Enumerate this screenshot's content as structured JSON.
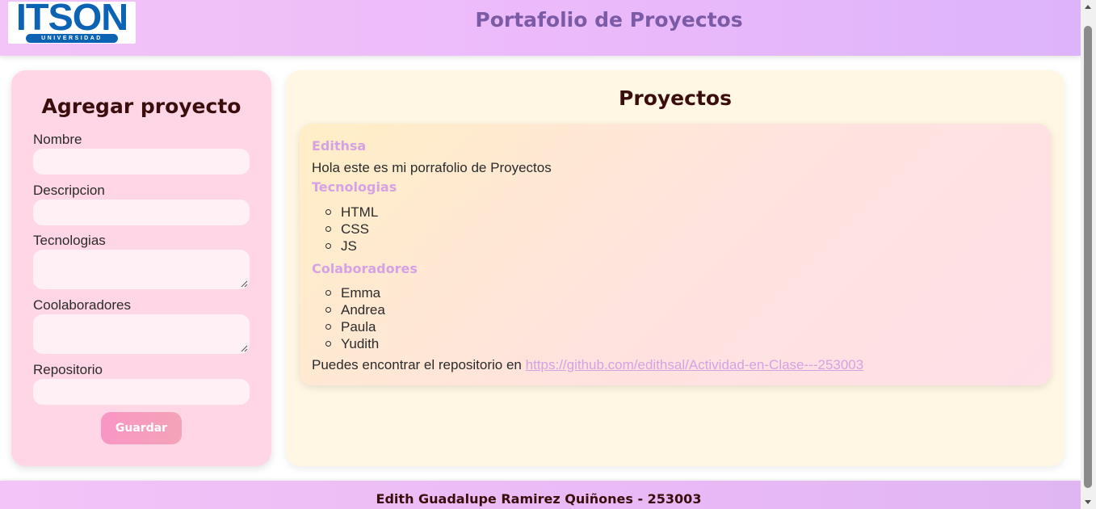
{
  "header": {
    "logo_text": "ITSON",
    "logo_subtext": "UNIVERSIDAD",
    "title": "Portafolio de Proyectos"
  },
  "form": {
    "title": "Agregar proyecto",
    "fields": {
      "nombre": "Nombre",
      "descripcion": "Descripcion",
      "tecnologias": "Tecnologias",
      "colaboradores": "Coolaboradores",
      "repositorio": "Repositorio"
    },
    "values": {
      "nombre": "",
      "descripcion": "",
      "tecnologias": "",
      "colaboradores": "",
      "repositorio": ""
    },
    "save_label": "Guardar"
  },
  "projects": {
    "title": "Proyectos",
    "items": [
      {
        "name": "Edithsa",
        "description": "Hola este es mi porrafolio de Proyectos",
        "tech_heading": "Tecnologias",
        "technologies": [
          "HTML",
          "CSS",
          "JS"
        ],
        "collab_heading": "Colaboradores",
        "collaborators": [
          "Emma",
          "Andrea",
          "Paula",
          "Yudith"
        ],
        "repo_prefix": "Puedes encontrar el repositorio en ",
        "repo_url": "https://github.com/edithsal/Actividad-en-Clase---253003"
      }
    ]
  },
  "footer": {
    "text": "Edith Guadalupe Ramirez Quiñones - 253003"
  },
  "colors": {
    "header_gradient_start": "#f2c4f7",
    "header_gradient_end": "#ddb3fb",
    "title_color": "#7b5aa6",
    "form_bg": "#ffd6e5",
    "panel_bg": "#fff6e3",
    "accent_heading": "#d6a2e3",
    "dark_text": "#3b0d0d",
    "button_pink": "#f996c4",
    "logo_blue": "#0d63b3"
  }
}
